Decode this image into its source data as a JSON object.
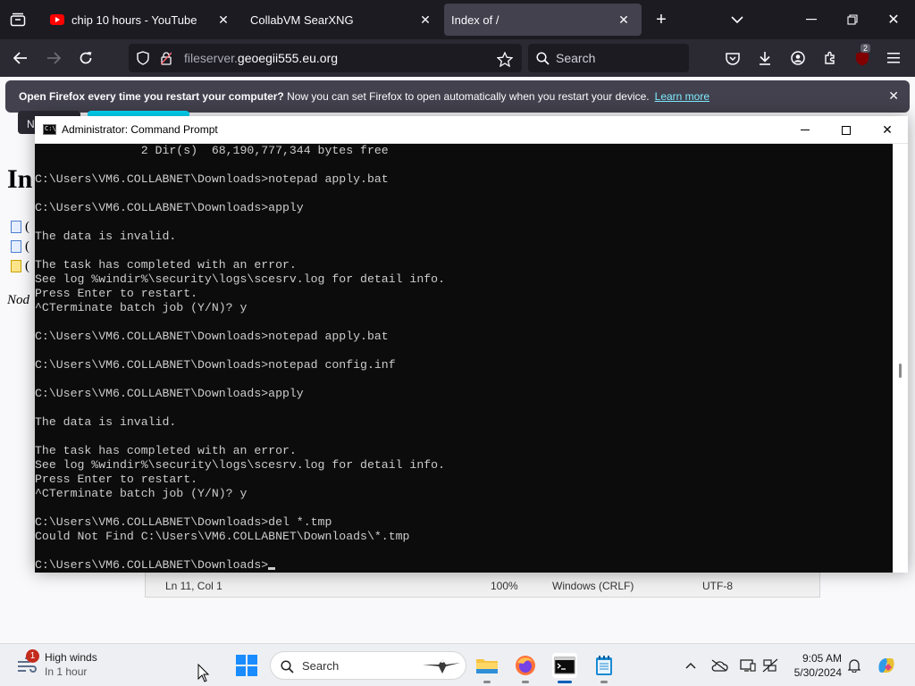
{
  "browser": {
    "tabs": [
      {
        "title": "chip 10 hours - YouTube",
        "icon": "youtube-icon",
        "active": false
      },
      {
        "title": "CollabVM SearXNG",
        "icon": "none",
        "active": false
      },
      {
        "title": "Index of /",
        "icon": "none",
        "active": true
      }
    ],
    "url": {
      "prefix": "fileserver.",
      "domain": "geoegii555.eu.org"
    },
    "search_placeholder": "Search",
    "extension_badge": "2",
    "notification": {
      "bold": "Open Firefox every time you restart your computer?",
      "text": "Now you can set Firefox to open automatically when you restart your device.",
      "link": "Learn more",
      "button_partial": "N"
    }
  },
  "page": {
    "heading": "In",
    "row_prefix": "(",
    "footer_partial": "Nod"
  },
  "notepad_status": {
    "position": "Ln 11, Col 1",
    "zoom": "100%",
    "line_ending": "Windows (CRLF)",
    "encoding": "UTF-8"
  },
  "cmd": {
    "title": "Administrator: Command Prompt",
    "lines": [
      "               2 Dir(s)  68,190,777,344 bytes free",
      "",
      "C:\\Users\\VM6.COLLABNET\\Downloads>notepad apply.bat",
      "",
      "C:\\Users\\VM6.COLLABNET\\Downloads>apply",
      "",
      "The data is invalid.",
      "",
      "The task has completed with an error.",
      "See log %windir%\\security\\logs\\scesrv.log for detail info.",
      "Press Enter to restart.",
      "^CTerminate batch job (Y/N)? y",
      "",
      "C:\\Users\\VM6.COLLABNET\\Downloads>notepad apply.bat",
      "",
      "C:\\Users\\VM6.COLLABNET\\Downloads>notepad config.inf",
      "",
      "C:\\Users\\VM6.COLLABNET\\Downloads>apply",
      "",
      "The data is invalid.",
      "",
      "The task has completed with an error.",
      "See log %windir%\\security\\logs\\scesrv.log for detail info.",
      "Press Enter to restart.",
      "^CTerminate batch job (Y/N)? y",
      "",
      "C:\\Users\\VM6.COLLABNET\\Downloads>del *.tmp",
      "Could Not Find C:\\Users\\VM6.COLLABNET\\Downloads\\*.tmp",
      ""
    ],
    "prompt": "C:\\Users\\VM6.COLLABNET\\Downloads>"
  },
  "taskbar": {
    "weather": {
      "title": "High winds",
      "subtitle": "In 1 hour",
      "badge": "1"
    },
    "search_label": "Search",
    "time": "9:05 AM",
    "date": "5/30/2024",
    "apps": [
      "file-explorer-icon",
      "firefox-icon",
      "command-prompt-icon",
      "notepad-icon"
    ]
  }
}
